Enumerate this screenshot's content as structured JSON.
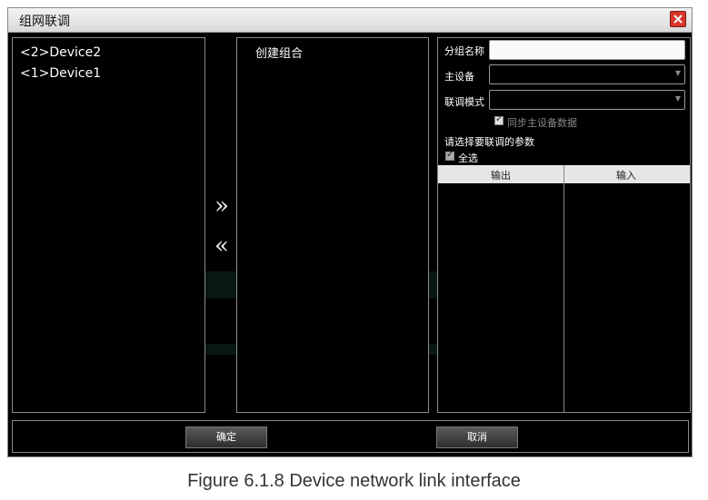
{
  "dialog": {
    "title": "组网联调",
    "devices": [
      "<2>Device2",
      "<1>Device1"
    ],
    "arrow_add": "»",
    "arrow_remove": "«",
    "group_panel_title": "创建组合",
    "form": {
      "group_name_label": "分组名称",
      "group_name_value": "",
      "master_label": "主设备",
      "master_value": "",
      "mode_label": "联调模式",
      "mode_value": "",
      "sync_label": "同步主设备数据",
      "params_label": "请选择要联调的参数",
      "select_all_label": "全选"
    },
    "table": {
      "col_output": "输出",
      "col_input": "输入"
    },
    "buttons": {
      "confirm": "确定",
      "cancel": "取消"
    }
  },
  "caption": "Figure 6.1.8 Device network link interface",
  "colors": {
    "background": "#000000",
    "border": "#8a8a8a",
    "close": "#d9352a"
  },
  "icons": [
    "close-icon",
    "double-chevron-right-icon",
    "double-chevron-left-icon",
    "dropdown-arrow-icon",
    "check-icon"
  ]
}
